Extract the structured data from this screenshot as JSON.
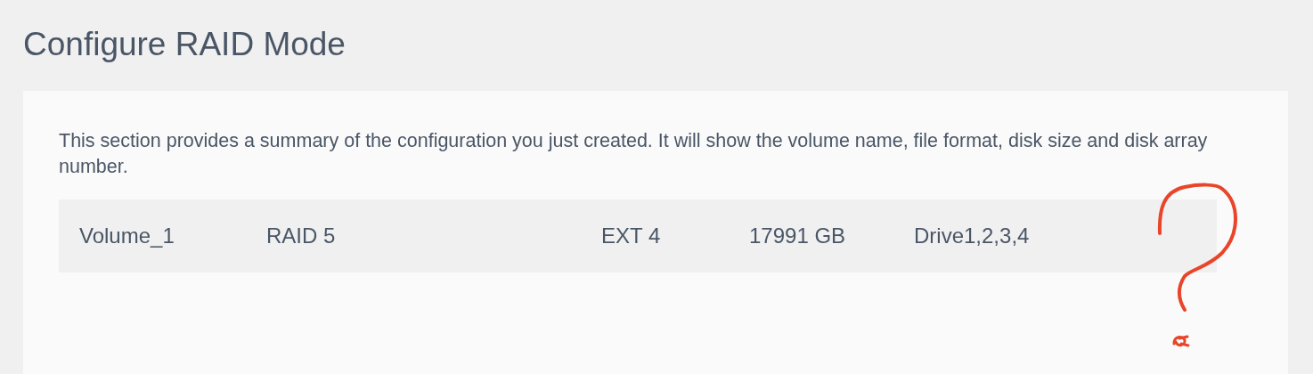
{
  "page": {
    "title": "Configure RAID Mode"
  },
  "summary": {
    "description": "This section provides a summary of the configuration you just created. It will show the volume name, file format, disk size and disk array number.",
    "row": [
      "Volume_1",
      "RAID 5",
      "EXT 4",
      "17991 GB",
      "Drive1,2,3,4"
    ]
  }
}
